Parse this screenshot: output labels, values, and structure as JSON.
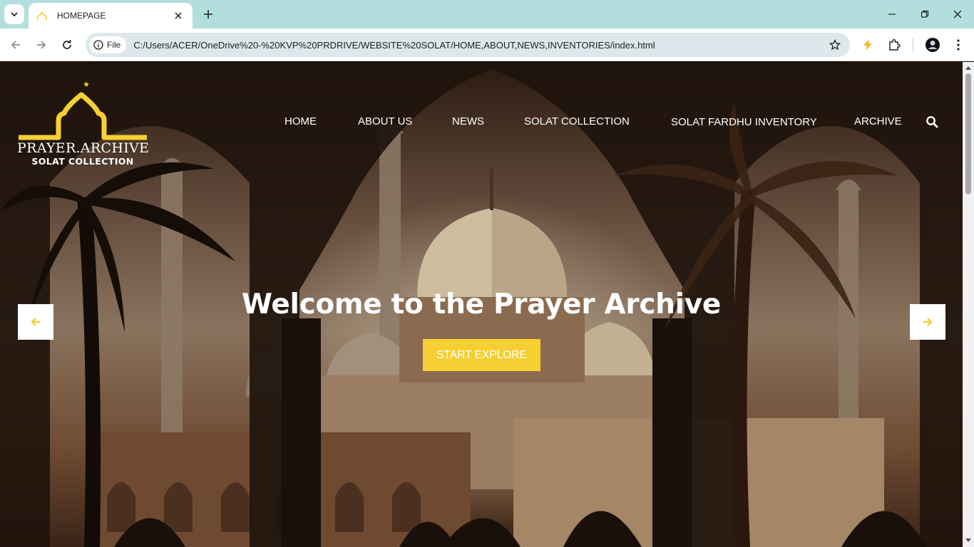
{
  "browser": {
    "tab_title": "HOMEPAGE",
    "chip_label": "File",
    "url": "C:/Users/ACER/OneDrive%20-%20KVP%20PRDRIVE/WEBSITE%20SOLAT/HOME,ABOUT,NEWS,INVENTORIES/index.html",
    "icons": [
      "tab-search-icon",
      "favicon-mosque-icon",
      "close-icon",
      "plus-icon",
      "minimize-icon",
      "restore-icon",
      "window-close-icon",
      "back-icon",
      "forward-icon",
      "reload-icon",
      "info-icon",
      "star-icon",
      "bolt-extension-icon",
      "puzzle-icon",
      "profile-avatar-icon",
      "kebab-menu-icon"
    ]
  },
  "site": {
    "logo_line1": "PRAYER.ARCHIVE",
    "logo_line2": "SOLAT COLLECTION",
    "nav": [
      {
        "label": "HOME"
      },
      {
        "label": "ABOUT US"
      },
      {
        "label": "NEWS"
      },
      {
        "label": "SOLAT COLLECTION"
      },
      {
        "label": "SOLAT FARDHU INVENTORY"
      },
      {
        "label": "ARCHIVE"
      }
    ],
    "hero": {
      "title": "Welcome to the Prayer Archive",
      "button": "START EXPLORE"
    },
    "colors": {
      "accent": "#f6cf32",
      "tabstrip": "#b2dfdd",
      "hero_text": "#ffffff"
    }
  }
}
